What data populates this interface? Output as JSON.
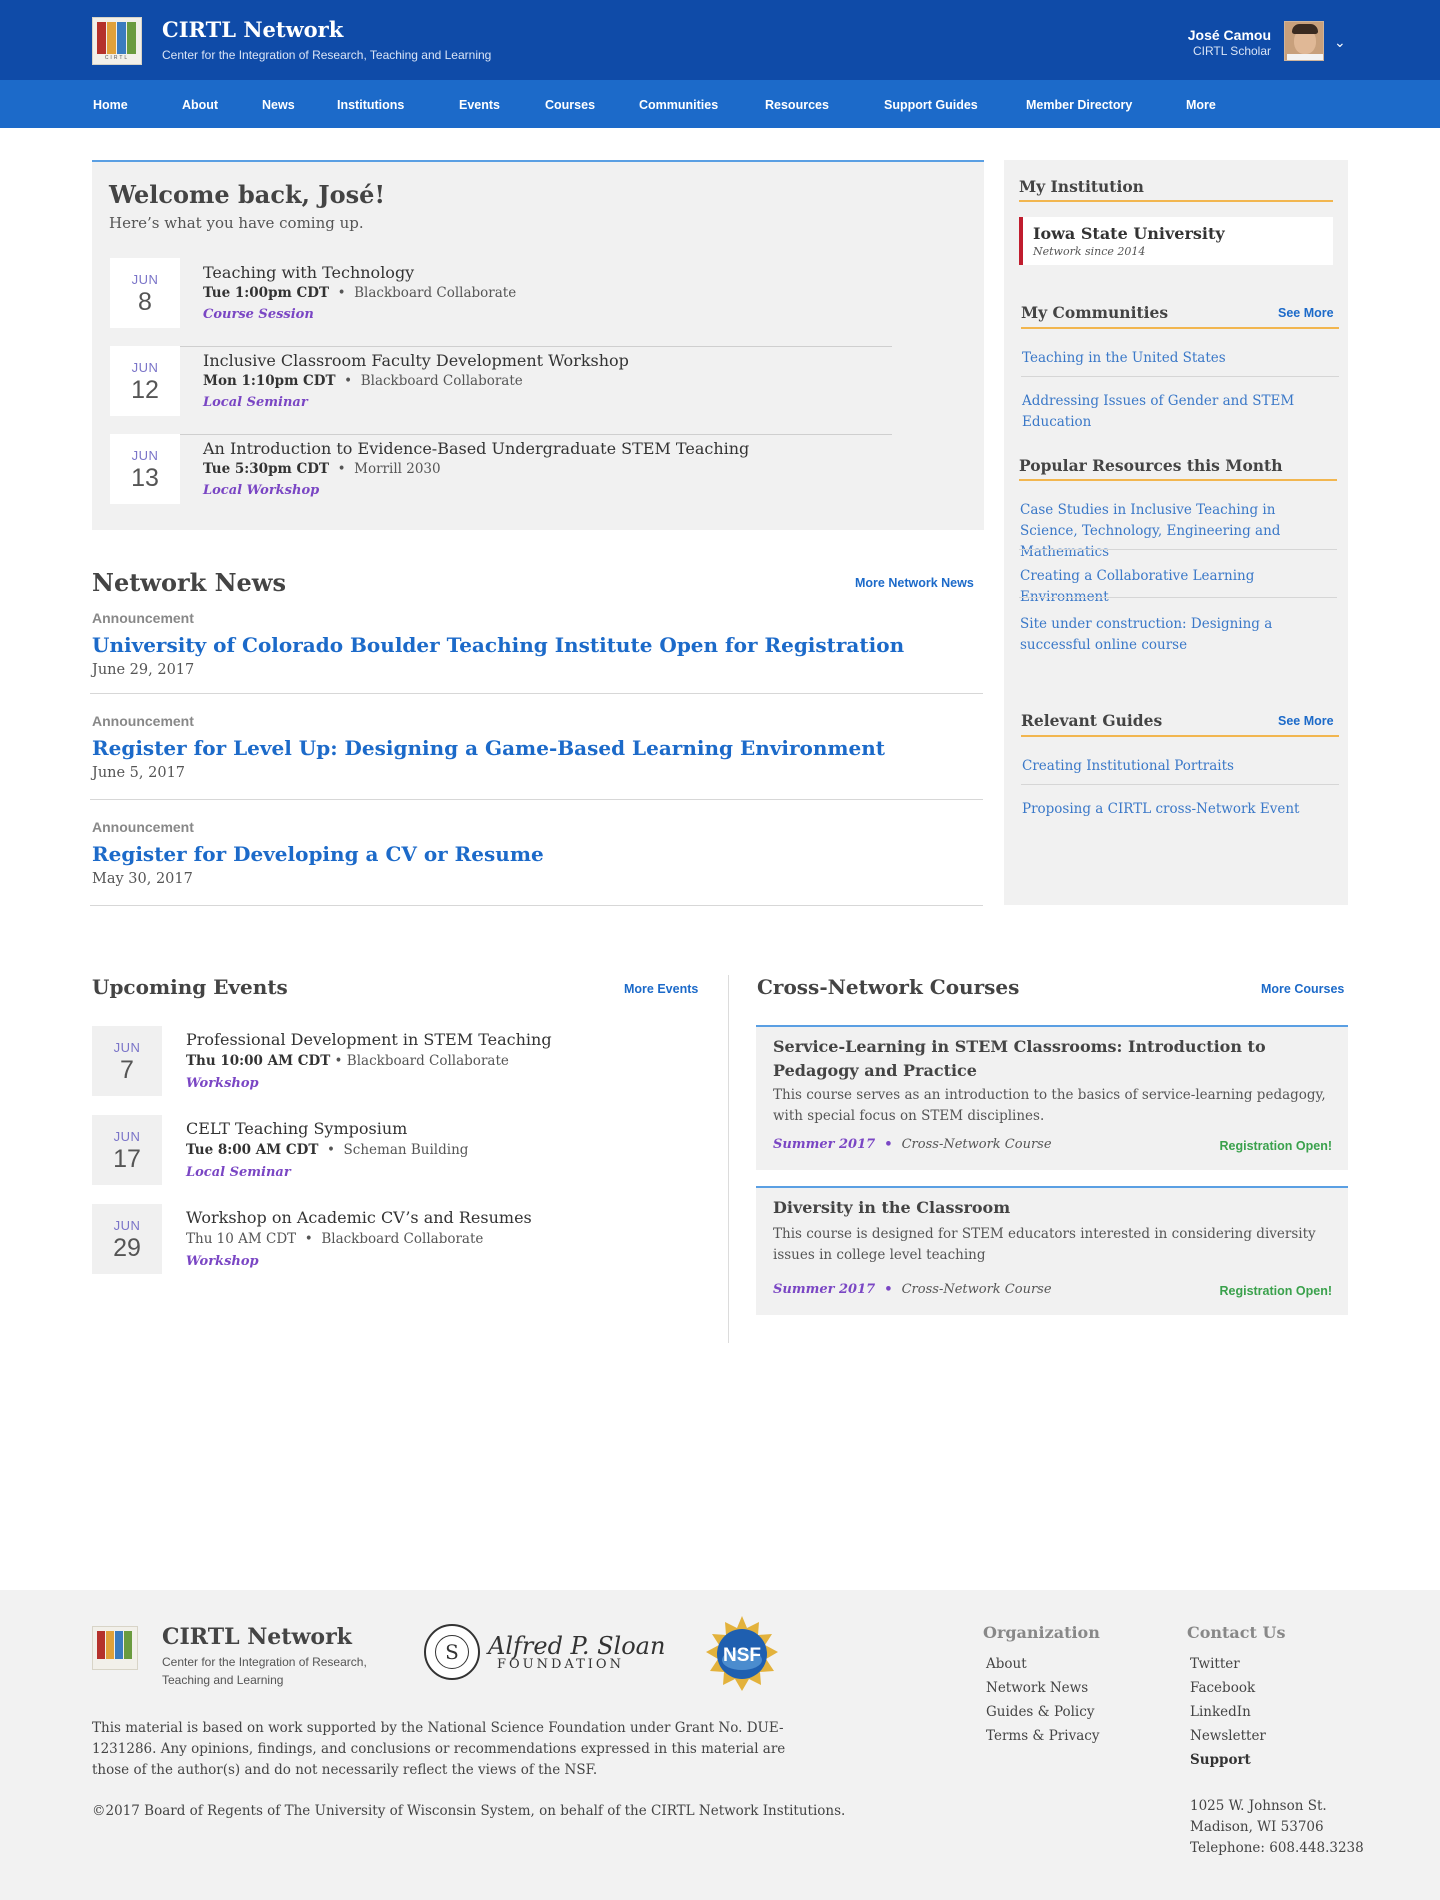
{
  "header": {
    "title": "CIRTL Network",
    "subtitle": "Center for the Integration of Research, Teaching and Learning",
    "user_name": "José Camou",
    "user_role": "CIRTL Scholar"
  },
  "nav": [
    "Home",
    "About",
    "News",
    "Institutions",
    "Events",
    "Courses",
    "Communities",
    "Resources",
    "Support Guides",
    "Member Directory",
    "More"
  ],
  "welcome": {
    "title": "Welcome back, José!",
    "subtitle": "Here’s what you have coming up.",
    "events": [
      {
        "month": "JUN",
        "day": "8",
        "title": "Teaching with Technology",
        "time": "Tue 1:00pm CDT",
        "place": "Blackboard Collaborate",
        "type": "Course Session"
      },
      {
        "month": "JUN",
        "day": "12",
        "title": "Inclusive Classroom Faculty Development Workshop",
        "time": "Mon 1:10pm CDT",
        "place": "Blackboard Collaborate",
        "type": "Local Seminar"
      },
      {
        "month": "JUN",
        "day": "13",
        "title": "An Introduction to Evidence-Based Undergraduate STEM Teaching",
        "time": "Tue 5:30pm CDT",
        "place": "Morrill 2030",
        "type": "Local Workshop"
      }
    ]
  },
  "news": {
    "heading": "Network News",
    "more": "More Network News",
    "items": [
      {
        "kind": "Announcement",
        "title": "University of Colorado Boulder Teaching Institute Open for Registration",
        "date": "June 29, 2017"
      },
      {
        "kind": "Announcement",
        "title": "Register for Level Up: Designing a Game-Based Learning Environment",
        "date": "June 5, 2017"
      },
      {
        "kind": "Announcement",
        "title": "Register for Developing a CV or Resume",
        "date": "May 30, 2017"
      }
    ]
  },
  "sidebar": {
    "institution_heading": "My Institution",
    "institution_name": "Iowa State University",
    "institution_since": "Network since 2014",
    "communities_heading": "My Communities",
    "communities_more": "See More",
    "communities": [
      "Teaching in the United States",
      "Addressing Issues of Gender and STEM Education"
    ],
    "resources_heading": "Popular Resources this Month",
    "resources": [
      "Case Studies in Inclusive Teaching in Science, Technology, Engineering and Mathematics",
      "Creating a Collaborative Learning Environment",
      "Site under construction: Designing a successful online course"
    ],
    "guides_heading": "Relevant Guides",
    "guides_more": "See More",
    "guides": [
      "Creating Institutional Portraits",
      "Proposing a CIRTL cross-Network Event"
    ]
  },
  "events": {
    "heading": "Upcoming Events",
    "more": "More Events",
    "items": [
      {
        "month": "JUN",
        "day": "7",
        "title": "Professional Development in STEM Teaching",
        "time": "Thu 10:00 AM CDT",
        "place": "Blackboard Collaborate",
        "type": "Workshop"
      },
      {
        "month": "JUN",
        "day": "17",
        "title": "CELT Teaching Symposium",
        "time": "Tue 8:00 AM CDT",
        "place": "Scheman Building",
        "type": "Local Seminar"
      },
      {
        "month": "JUN",
        "day": "29",
        "title": "Workshop on Academic CV’s and Resumes",
        "time": "Thu 10 AM CDT",
        "place": "Blackboard Collaborate",
        "type": "Workshop"
      }
    ]
  },
  "courses": {
    "heading": "Cross-Network Courses",
    "more": "More Courses",
    "items": [
      {
        "title": "Service-Learning in STEM Classrooms: Introduction to Pedagogy and Practice",
        "desc": "This course serves as an introduction to the basics of service-learning pedagogy, with special focus on STEM disciplines.",
        "term": "Summer 2017",
        "kind": "Cross-Network Course",
        "status": "Registration Open!"
      },
      {
        "title": "Diversity in the Classroom",
        "desc": "This course is designed for STEM educators interested in considering diversity issues in college level teaching",
        "term": "Summer 2017",
        "kind": "Cross-Network Course",
        "status": "Registration Open!"
      }
    ]
  },
  "footer": {
    "title": "CIRTL Network",
    "subtitle": "Center for the Integration of Research, Teaching and Learning",
    "sloan_name": "Alfred P. Sloan",
    "sloan_foundation": "FOUNDATION",
    "sloan_seal_letter": "S",
    "nsf_label": "NSF",
    "disclaimer": "This material is based on work supported by the National Science Foundation under Grant No. DUE-1231286. Any opinions, findings, and conclusions or recommendations expressed in this material are those of the author(s) and do not necessarily reflect the views of the NSF.",
    "copyright": "©2017 Board of Regents of The University of Wisconsin System, on behalf of the CIRTL Network Institutions.",
    "org_heading": "Organization",
    "org_links": [
      "About",
      "Network News",
      "Guides & Policy",
      "Terms & Privacy"
    ],
    "contact_heading": "Contact Us",
    "contact_links": [
      "Twitter",
      "Facebook",
      "LinkedIn",
      "Newsletter"
    ],
    "support": "Support",
    "address": [
      "1025 W. Johnson St.",
      "Madison, WI 53706",
      "Telephone: 608.448.3238"
    ]
  },
  "colors": {
    "header": "#0f4ba8",
    "nav": "#1c6ac9",
    "link": "#1c6ac9",
    "event_type": "#7a46c4",
    "accent_line": "#f2b64f",
    "status_open": "#3aa14c"
  }
}
